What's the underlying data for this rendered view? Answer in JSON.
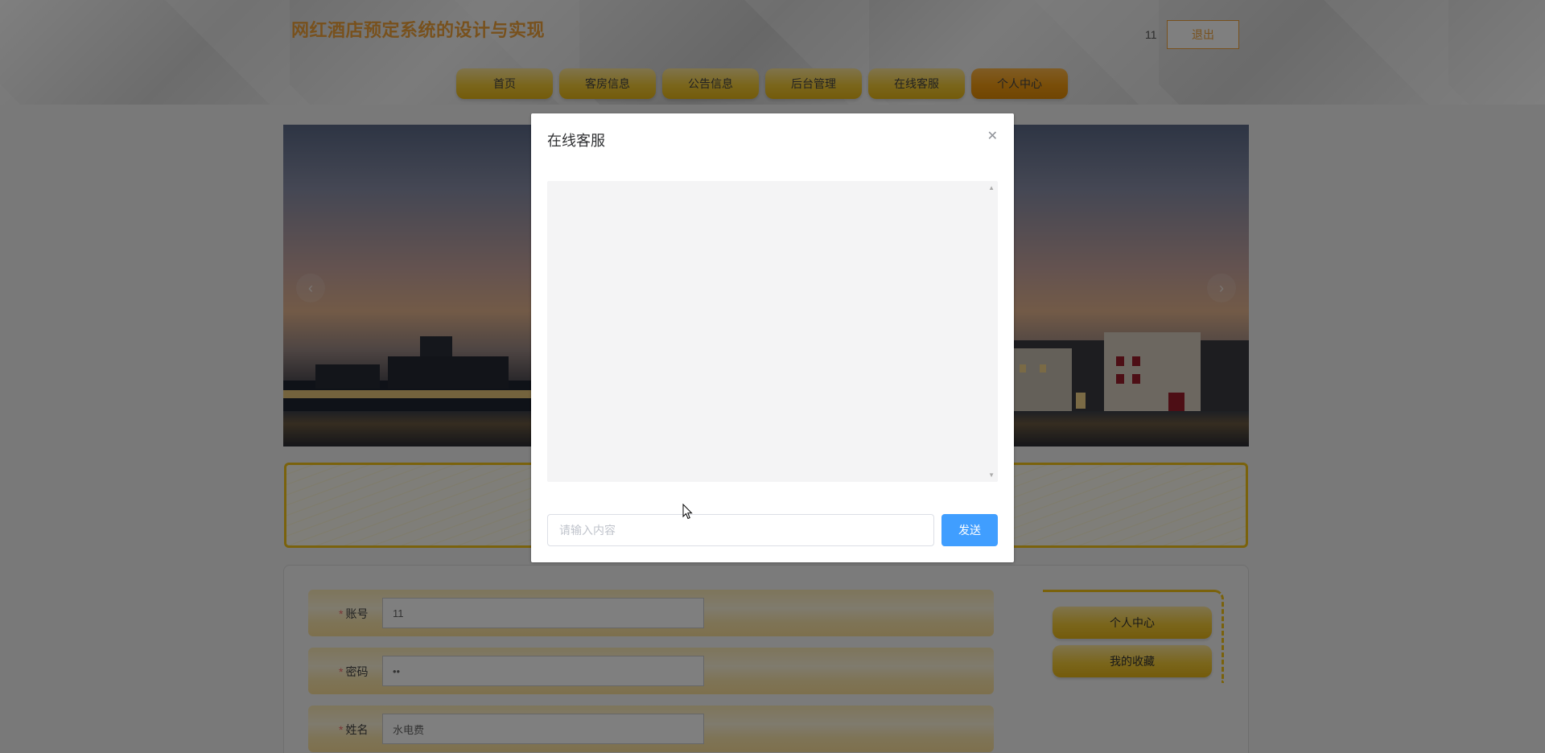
{
  "header": {
    "site_title": "网红酒店预定系统的设计与实现",
    "user_name": "11",
    "logout_label": "退出"
  },
  "nav": {
    "items": [
      {
        "label": "首页",
        "active": false
      },
      {
        "label": "客房信息",
        "active": false
      },
      {
        "label": "公告信息",
        "active": false
      },
      {
        "label": "后台管理",
        "active": false
      },
      {
        "label": "在线客服",
        "active": false
      },
      {
        "label": "个人中心",
        "active": true
      }
    ]
  },
  "banner": {
    "prev_icon": "chevron-left-icon",
    "next_icon": "chevron-right-icon"
  },
  "form": {
    "fields": [
      {
        "label": "账号",
        "required": true,
        "value": "11"
      },
      {
        "label": "密码",
        "required": true,
        "value": "••"
      },
      {
        "label": "姓名",
        "required": true,
        "value": "水电费"
      }
    ]
  },
  "side_menu": {
    "items": [
      {
        "label": "个人中心"
      },
      {
        "label": "我的收藏"
      }
    ]
  },
  "dialog": {
    "title": "在线客服",
    "close_icon": "close-icon",
    "input_placeholder": "请输入内容",
    "input_value": "",
    "send_label": "发送"
  },
  "colors": {
    "brand_orange": "#f0a33a",
    "nav_yellow": "#f5cc38",
    "nav_active": "#f39c12",
    "send_blue": "#409eff"
  }
}
